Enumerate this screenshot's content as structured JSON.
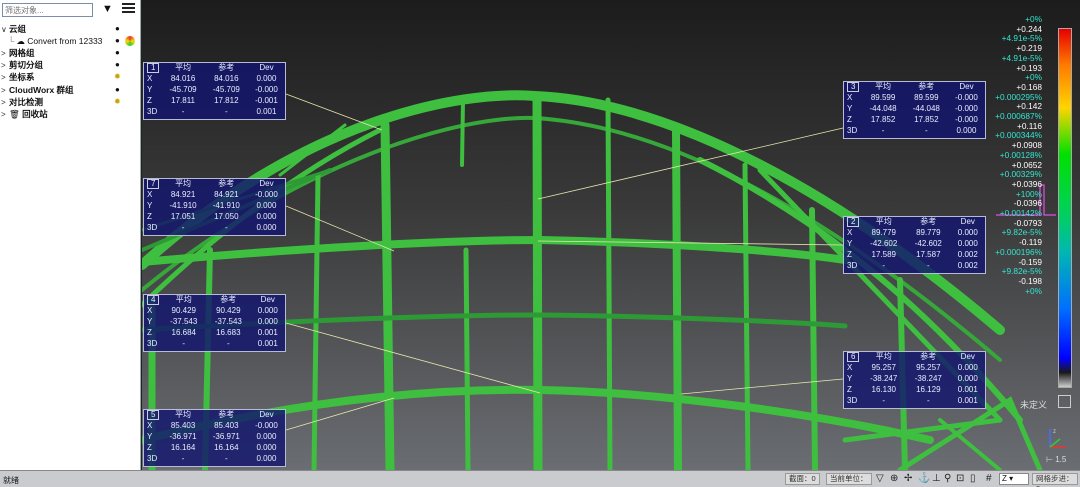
{
  "tree": {
    "filter_placeholder": "筛选对象...",
    "nodes": [
      {
        "label": "云组",
        "bold": true,
        "arrow": "∨"
      },
      {
        "label": "Convert from 12333",
        "bold": false,
        "arrow": ""
      },
      {
        "label": "网格组",
        "bold": true,
        "arrow": ">"
      },
      {
        "label": "剪切分组",
        "bold": true,
        "arrow": ">"
      },
      {
        "label": "坐标系",
        "bold": true,
        "arrow": ">"
      },
      {
        "label": "CloudWorx 群组",
        "bold": true,
        "arrow": ">"
      },
      {
        "label": "对比检测",
        "bold": true,
        "arrow": ">"
      },
      {
        "label": "回收站",
        "bold": true,
        "arrow": ">"
      }
    ]
  },
  "table_headers": {
    "avg": "平均",
    "ref": "参考",
    "dev": "Dev"
  },
  "row_labels": [
    "X",
    "Y",
    "Z",
    "3D"
  ],
  "measurements": [
    {
      "id": "1",
      "rows": [
        [
          "84.016",
          "84.016",
          "0.000"
        ],
        [
          "-45.709",
          "-45.709",
          "-0.000"
        ],
        [
          "17.811",
          "17.812",
          "-0.001"
        ],
        [
          "-",
          "-",
          "0.001"
        ]
      ]
    },
    {
      "id": "7",
      "rows": [
        [
          "84.921",
          "84.921",
          "-0.000"
        ],
        [
          "-41.910",
          "-41.910",
          "0.000"
        ],
        [
          "17.051",
          "17.050",
          "0.000"
        ],
        [
          "-",
          "-",
          "0.000"
        ]
      ]
    },
    {
      "id": "4",
      "rows": [
        [
          "90.429",
          "90.429",
          "0.000"
        ],
        [
          "-37.543",
          "-37.543",
          "0.000"
        ],
        [
          "16.684",
          "16.683",
          "0.001"
        ],
        [
          "-",
          "-",
          "0.001"
        ]
      ]
    },
    {
      "id": "5",
      "rows": [
        [
          "85.403",
          "85.403",
          "-0.000"
        ],
        [
          "-36.971",
          "-36.971",
          "0.000"
        ],
        [
          "16.164",
          "16.164",
          "0.000"
        ],
        [
          "-",
          "-",
          "0.000"
        ]
      ]
    },
    {
      "id": "3",
      "rows": [
        [
          "89.599",
          "89.599",
          "-0.000"
        ],
        [
          "-44.048",
          "-44.048",
          "-0.000"
        ],
        [
          "17.852",
          "17.852",
          "-0.000"
        ],
        [
          "-",
          "-",
          "0.000"
        ]
      ]
    },
    {
      "id": "2",
      "rows": [
        [
          "89.779",
          "89.779",
          "0.000"
        ],
        [
          "-42.602",
          "-42.602",
          "0.000"
        ],
        [
          "17.589",
          "17.587",
          "0.002"
        ],
        [
          "-",
          "-",
          "0.002"
        ]
      ]
    },
    {
      "id": "6",
      "rows": [
        [
          "95.257",
          "95.257",
          "0.000"
        ],
        [
          "-38.247",
          "-38.247",
          "0.000"
        ],
        [
          "16.130",
          "16.129",
          "0.001"
        ],
        [
          "-",
          "-",
          "0.001"
        ]
      ]
    }
  ],
  "scale_labels": [
    {
      "t": "+0%",
      "c": "c"
    },
    {
      "t": "+0.244",
      "c": "w"
    },
    {
      "t": "+4.91e-5%",
      "c": "c"
    },
    {
      "t": "+0.219",
      "c": "w"
    },
    {
      "t": "+4.91e-5%",
      "c": "c"
    },
    {
      "t": "+0.193",
      "c": "w"
    },
    {
      "t": "+0%",
      "c": "c"
    },
    {
      "t": "+0.168",
      "c": "w"
    },
    {
      "t": "+0.000295%",
      "c": "c"
    },
    {
      "t": "+0.142",
      "c": "w"
    },
    {
      "t": "+0.000687%",
      "c": "c"
    },
    {
      "t": "+0.116",
      "c": "w"
    },
    {
      "t": "+0.000344%",
      "c": "c"
    },
    {
      "t": "+0.0908",
      "c": "w"
    },
    {
      "t": "+0.00128%",
      "c": "c"
    },
    {
      "t": "+0.0652",
      "c": "w"
    },
    {
      "t": "+0.00329%",
      "c": "c"
    },
    {
      "t": "+0.0396",
      "c": "w"
    },
    {
      "t": "+100%",
      "c": "c"
    },
    {
      "t": "-0.0396",
      "c": "w"
    },
    {
      "t": "+0.00142%",
      "c": "c"
    },
    {
      "t": "-0.0793",
      "c": "w"
    },
    {
      "t": "+9.82e-5%",
      "c": "c"
    },
    {
      "t": "-0.119",
      "c": "w"
    },
    {
      "t": "+0.000196%",
      "c": "c"
    },
    {
      "t": "-0.159",
      "c": "w"
    },
    {
      "t": "+9.82e-5%",
      "c": "c"
    },
    {
      "t": "-0.198",
      "c": "w"
    },
    {
      "t": "+0%",
      "c": "c"
    }
  ],
  "undefined_label": "未定义",
  "ruler_value": "1.5",
  "watermark": "大数跨境",
  "status": {
    "ready": "就绪",
    "section_label": "截面：",
    "section_value": "0",
    "unit_label": "当前单位：",
    "axis_value": "Z",
    "grid_step_label": "网格步进：",
    "grid_step_value": "2"
  },
  "colors": {
    "steel": "#3fbf3f",
    "steel_dark": "#1f8f2a",
    "panel": "#12166e"
  }
}
